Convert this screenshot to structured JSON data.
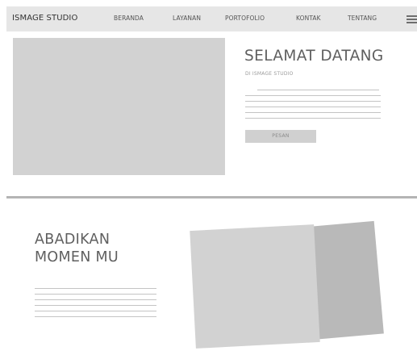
{
  "navbar": {
    "brand": "ISMAGE STUDIO",
    "items": [
      {
        "label": "BERANDA"
      },
      {
        "label": "LAYANAN"
      },
      {
        "label": "PORTOFOLIO"
      },
      {
        "label": "KONTAK"
      },
      {
        "label": "TENTANG"
      }
    ],
    "menu_icon": "hamburger-menu-icon"
  },
  "hero": {
    "title": "SELAMAT DATANG",
    "subtitle": "DI ISMAGE STUDIO",
    "button_label": "PESAN"
  },
  "section2": {
    "title_line1": "ABADIKAN",
    "title_line2": "MOMEN MU"
  },
  "colors": {
    "nav_background": "#e6e6e6",
    "placeholder_light": "#d2d2d2",
    "placeholder_dark": "#b9b9b9",
    "divider": "#b4b4b4",
    "text_lines": "#c4c4c4"
  }
}
